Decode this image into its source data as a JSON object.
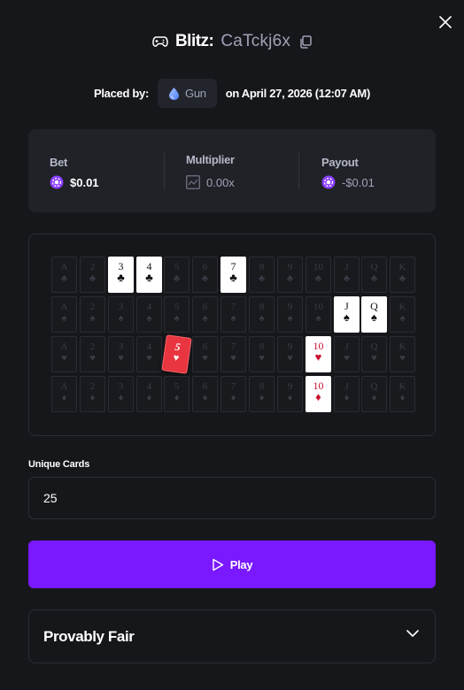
{
  "header": {
    "game_name": "Blitz:",
    "bet_id": "CaTckj6x",
    "placed_by_label": "Placed by:",
    "username": "Gun",
    "placed_on": "on April 27, 2026 (12:07 AM)"
  },
  "stats": {
    "bet": {
      "label": "Bet",
      "value": "$0.01"
    },
    "multiplier": {
      "label": "Multiplier",
      "value": "0.00x"
    },
    "payout": {
      "label": "Payout",
      "value": "-$0.01"
    }
  },
  "board": {
    "ranks": [
      "A",
      "2",
      "3",
      "4",
      "5",
      "6",
      "7",
      "8",
      "9",
      "10",
      "J",
      "Q",
      "K"
    ],
    "rows": [
      {
        "suit": "♣",
        "suit_name": "clubs",
        "revealed": [
          "3",
          "4",
          "7"
        ]
      },
      {
        "suit": "♠",
        "suit_name": "spades",
        "revealed": [
          "J",
          "Q"
        ]
      },
      {
        "suit": "♥",
        "suit_name": "hearts",
        "revealed": [
          "10"
        ],
        "highlighted": [
          "5"
        ]
      },
      {
        "suit": "♦",
        "suit_name": "diamonds",
        "revealed": [
          "10"
        ]
      }
    ]
  },
  "unique_cards": {
    "label": "Unique Cards",
    "value": "25"
  },
  "play_button": {
    "label": "Play"
  },
  "provably_fair": {
    "label": "Provably Fair"
  },
  "colors": {
    "background": "#16171b",
    "panel": "#202228",
    "accent": "#7a18ff",
    "chip": "#8b3dff",
    "red_card": "#e8353f"
  }
}
